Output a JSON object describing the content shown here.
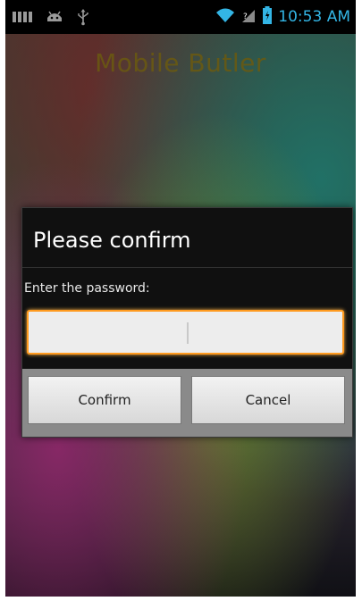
{
  "status_bar": {
    "time": "10:53 AM",
    "icons": [
      "notification-bars-icon",
      "android-icon",
      "usb-icon",
      "wifi-icon",
      "signal-icon",
      "battery-charging-icon"
    ]
  },
  "app": {
    "title": "Mobile Butler"
  },
  "dialog": {
    "title": "Please confirm",
    "message": "Enter the password:",
    "password_value": "",
    "confirm_label": "Confirm",
    "cancel_label": "Cancel"
  },
  "colors": {
    "accent": "#33b5e5",
    "focus_border": "#ff9a1f"
  }
}
